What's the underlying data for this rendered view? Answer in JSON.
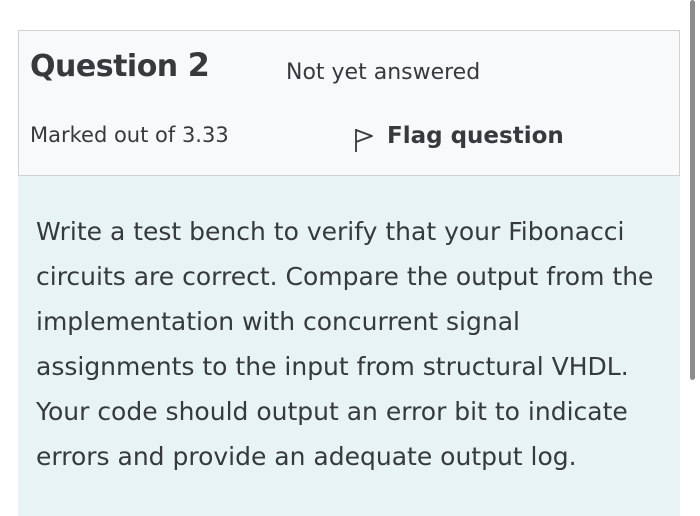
{
  "question": {
    "label": "Question",
    "number": "2",
    "state": "Not yet answered",
    "grade": "Marked out of 3.33",
    "flag_label": "Flag question",
    "flag_icon": "flag-icon",
    "text": "Write a test bench to verify that your Fibonacci circuits are correct. Compare the output from the implementation with concurrent signal assignments to the input from structural VHDL. Your code should output an error bit to indicate errors and provide an adequate output log."
  },
  "colors": {
    "info_background": "#f8f9fa",
    "text_background": "#e7f3f5",
    "text": "#373a3c"
  }
}
